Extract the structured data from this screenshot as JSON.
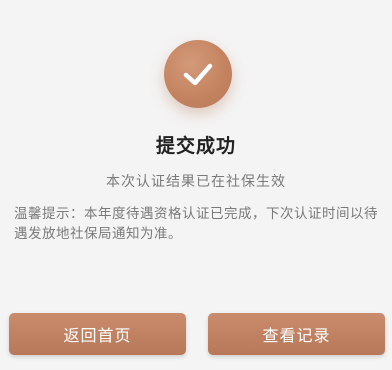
{
  "result": {
    "title": "提交成功",
    "subtitle": "本次认证结果已在社保生效",
    "notice": "温馨提示：本年度待遇资格认证已完成，下次认证时间以待遇发放地社保局通知为准。"
  },
  "actions": {
    "home_label": "返回首页",
    "records_label": "查看记录"
  },
  "colors": {
    "accent": "#c3825f",
    "background": "#f4f4f4"
  },
  "icons": {
    "success": "check-icon"
  }
}
